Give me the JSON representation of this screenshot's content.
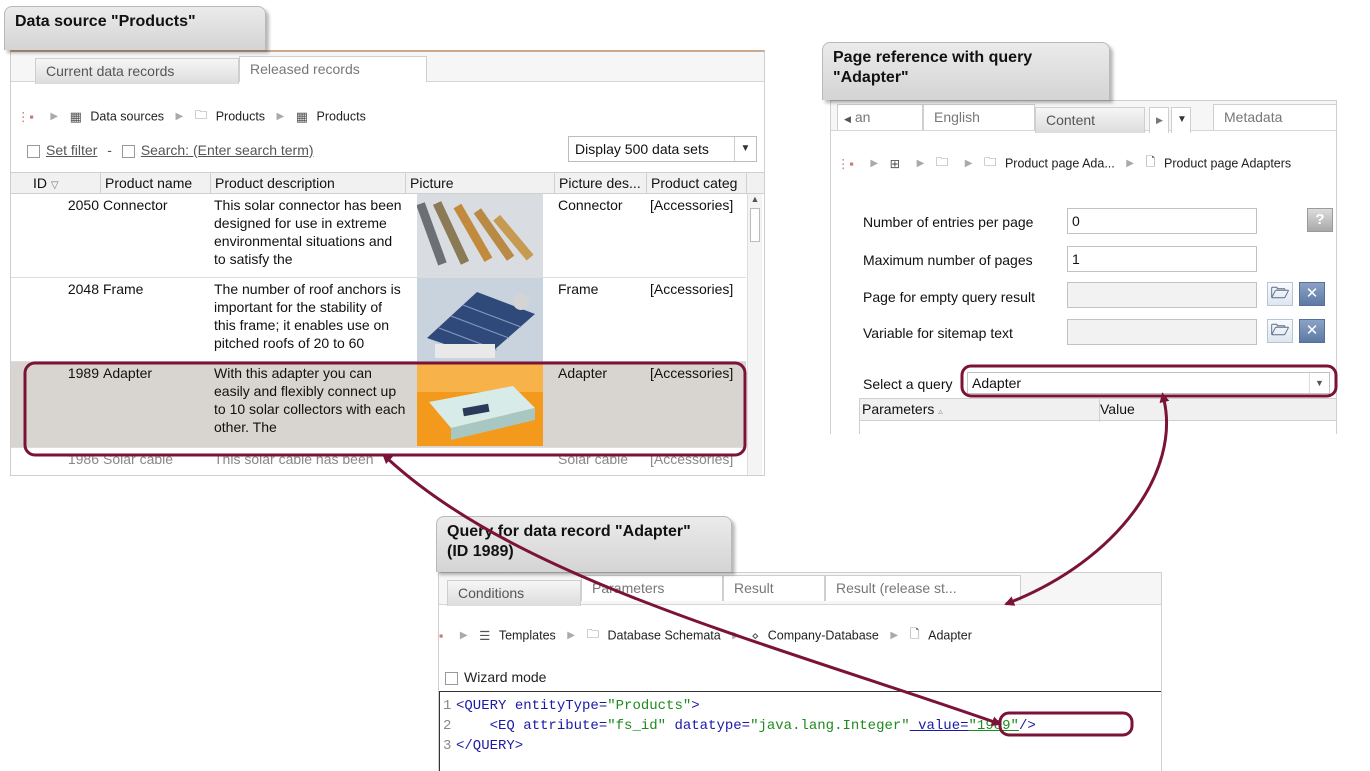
{
  "panel1": {
    "title": "Data source \"Products\"",
    "tabs": [
      "Current data records",
      "Released records"
    ],
    "breadcrumb": [
      "Data sources",
      "Products",
      "Products"
    ],
    "filter": {
      "set_filter": "Set filter",
      "dash": "-",
      "search": "Search: (Enter search term)",
      "display": "Display 500 data sets"
    },
    "columns": [
      "ID",
      "Product name",
      "Product description",
      "Picture",
      "Picture des...",
      "Product categ"
    ],
    "rows": [
      {
        "id": "2050",
        "name": "Connector",
        "desc": "This solar connector has been designed for use in extreme environmental situations and to satisfy the",
        "pic_desc": "Connector",
        "category": "[Accessories]"
      },
      {
        "id": "2048",
        "name": "Frame",
        "desc": "The number of roof anchors is important for the stability of this frame; it enables use on pitched roofs of 20 to 60",
        "pic_desc": "Frame",
        "category": "[Accessories]"
      },
      {
        "id": "1989",
        "name": "Adapter",
        "desc": "With this adapter you can easily and flexibly connect up to 10 solar collectors with each other. The",
        "pic_desc": "Adapter",
        "category": "[Accessories]"
      },
      {
        "id": "1986",
        "name": "Solar cable",
        "desc": "This solar cable has been",
        "pic_desc": "Solar cable",
        "category": "[Accessories]"
      }
    ]
  },
  "panel2": {
    "title_line1": "Page reference with query",
    "title_line2": "\"Adapter\"",
    "tabs": [
      "an",
      "English",
      "Content",
      "Metadata"
    ],
    "breadcrumb": [
      "Product page Ada...",
      "Product page Adapters"
    ],
    "fields": {
      "entries_label": "Number of entries per page",
      "entries_value": "0",
      "pages_label": "Maximum number of pages",
      "pages_value": "1",
      "empty_label": "Page for empty query result",
      "sitemap_label": "Variable for sitemap text",
      "query_label": "Select a query",
      "query_value": "Adapter"
    },
    "params_columns": [
      "Parameters",
      "Value"
    ]
  },
  "panel3": {
    "title_line1": "Query for data record \"Adapter\"",
    "title_line2": "(ID 1989)",
    "tabs": [
      "Conditions",
      "Parameters",
      "Result",
      "Result (release st..."
    ],
    "breadcrumb": [
      "Templates",
      "Database Schemata",
      "Company-Database",
      "Adapter"
    ],
    "wizard": "Wizard mode",
    "code": {
      "l1_num": "1",
      "l1_tag": "<QUERY ",
      "l1_attr": "entityType=",
      "l1_str": "\"Products\"",
      "l1_end": ">",
      "l2_num": "2",
      "l2_indent": "    ",
      "l2_tag": "<EQ ",
      "l2_a1": "attribute=",
      "l2_s1": "\"fs_id\"",
      "l2_a2": " datatype=",
      "l2_s2": "\"java.lang.Integer\"",
      "l2_a3": " value=",
      "l2_s3": "\"1989\"",
      "l2_end": "/>",
      "l3_num": "3",
      "l3_tag": "</QUERY>"
    }
  },
  "colors": {
    "highlight": "#7b1238",
    "selected_row": "#d8d4cf"
  }
}
